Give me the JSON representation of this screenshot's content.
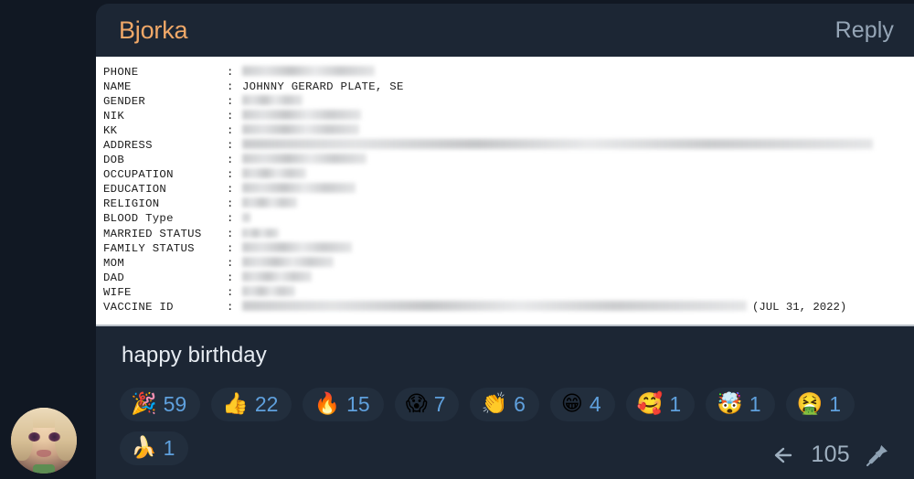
{
  "message": {
    "author": "Bjorka",
    "reply_label": "Reply",
    "body_text": "happy birthday",
    "reply_count": "105",
    "reply_arrow_icon": "reply-arrow-icon",
    "pin_icon": "pin-icon"
  },
  "document": {
    "rows": [
      {
        "label": "PHONE",
        "colon": ":",
        "redacted": true,
        "value": "",
        "redacted_width": 145
      },
      {
        "label": "NAME",
        "colon": ":",
        "redacted": false,
        "value": "JOHNNY GERARD PLATE, SE"
      },
      {
        "label": "GENDER",
        "colon": ":",
        "redacted": true,
        "value": "",
        "redacted_width": 66
      },
      {
        "label": "NIK",
        "colon": ":",
        "redacted": true,
        "value": "",
        "redacted_width": 130
      },
      {
        "label": "KK",
        "colon": ":",
        "redacted": true,
        "value": "",
        "redacted_width": 128
      },
      {
        "label": "ADDRESS",
        "colon": ":",
        "redacted": true,
        "value": "",
        "redacted_width": 690
      },
      {
        "label": "DOB",
        "colon": ":",
        "redacted": true,
        "value": "",
        "redacted_width": 136
      },
      {
        "label": "OCCUPATION",
        "colon": ":",
        "redacted": true,
        "value": "",
        "redacted_width": 70
      },
      {
        "label": "EDUCATION",
        "colon": ":",
        "redacted": true,
        "value": "",
        "redacted_width": 124
      },
      {
        "label": "RELIGION",
        "colon": ":",
        "redacted": true,
        "value": "",
        "redacted_width": 60
      },
      {
        "label": "BLOOD Type",
        "colon": ":",
        "redacted": true,
        "value": "",
        "redacted_width": 9
      },
      {
        "label": "MARRIED STATUS",
        "colon": ":",
        "redacted": true,
        "value": "",
        "redacted_width": 40
      },
      {
        "label": "FAMILY STATUS",
        "colon": ":",
        "redacted": true,
        "value": "",
        "redacted_width": 120
      },
      {
        "label": "MOM",
        "colon": ":",
        "redacted": true,
        "value": "",
        "redacted_width": 100
      },
      {
        "label": "DAD",
        "colon": ":",
        "redacted": true,
        "value": "",
        "redacted_width": 76
      },
      {
        "label": "WIFE",
        "colon": ":",
        "redacted": true,
        "value": "",
        "redacted_width": 58
      },
      {
        "label": "VACCINE ID",
        "colon": ":",
        "redacted": true,
        "value": "",
        "redacted_width": 552,
        "suffix": "(JUL 31, 2022)"
      }
    ]
  },
  "reactions": [
    {
      "emoji": "🎉",
      "name": "party-popper",
      "count": "59"
    },
    {
      "emoji": "👍",
      "name": "thumbs-up",
      "count": "22"
    },
    {
      "emoji": "🔥",
      "name": "fire",
      "count": "15"
    },
    {
      "emoji": "😱",
      "name": "screaming-face",
      "count": "7"
    },
    {
      "emoji": "👏",
      "name": "clapping-hands",
      "count": "6"
    },
    {
      "emoji": "😁",
      "name": "grinning-face",
      "count": "4"
    },
    {
      "emoji": "🥰",
      "name": "smiling-face-with-hearts",
      "count": "1"
    },
    {
      "emoji": "🤯",
      "name": "exploding-head",
      "count": "1"
    },
    {
      "emoji": "🤮",
      "name": "vomiting-face",
      "count": "1"
    },
    {
      "emoji": "🍌",
      "name": "banana",
      "count": "1"
    }
  ],
  "avatar": {
    "name": "user-avatar"
  },
  "colors": {
    "page_background": "#111823",
    "bubble_background": "#1c2634",
    "author_accent": "#f0a868",
    "reaction_background": "#222e3d",
    "reaction_count": "#5fa0dd",
    "reply_text": "#95a5b6",
    "document_background": "#ffffff"
  }
}
